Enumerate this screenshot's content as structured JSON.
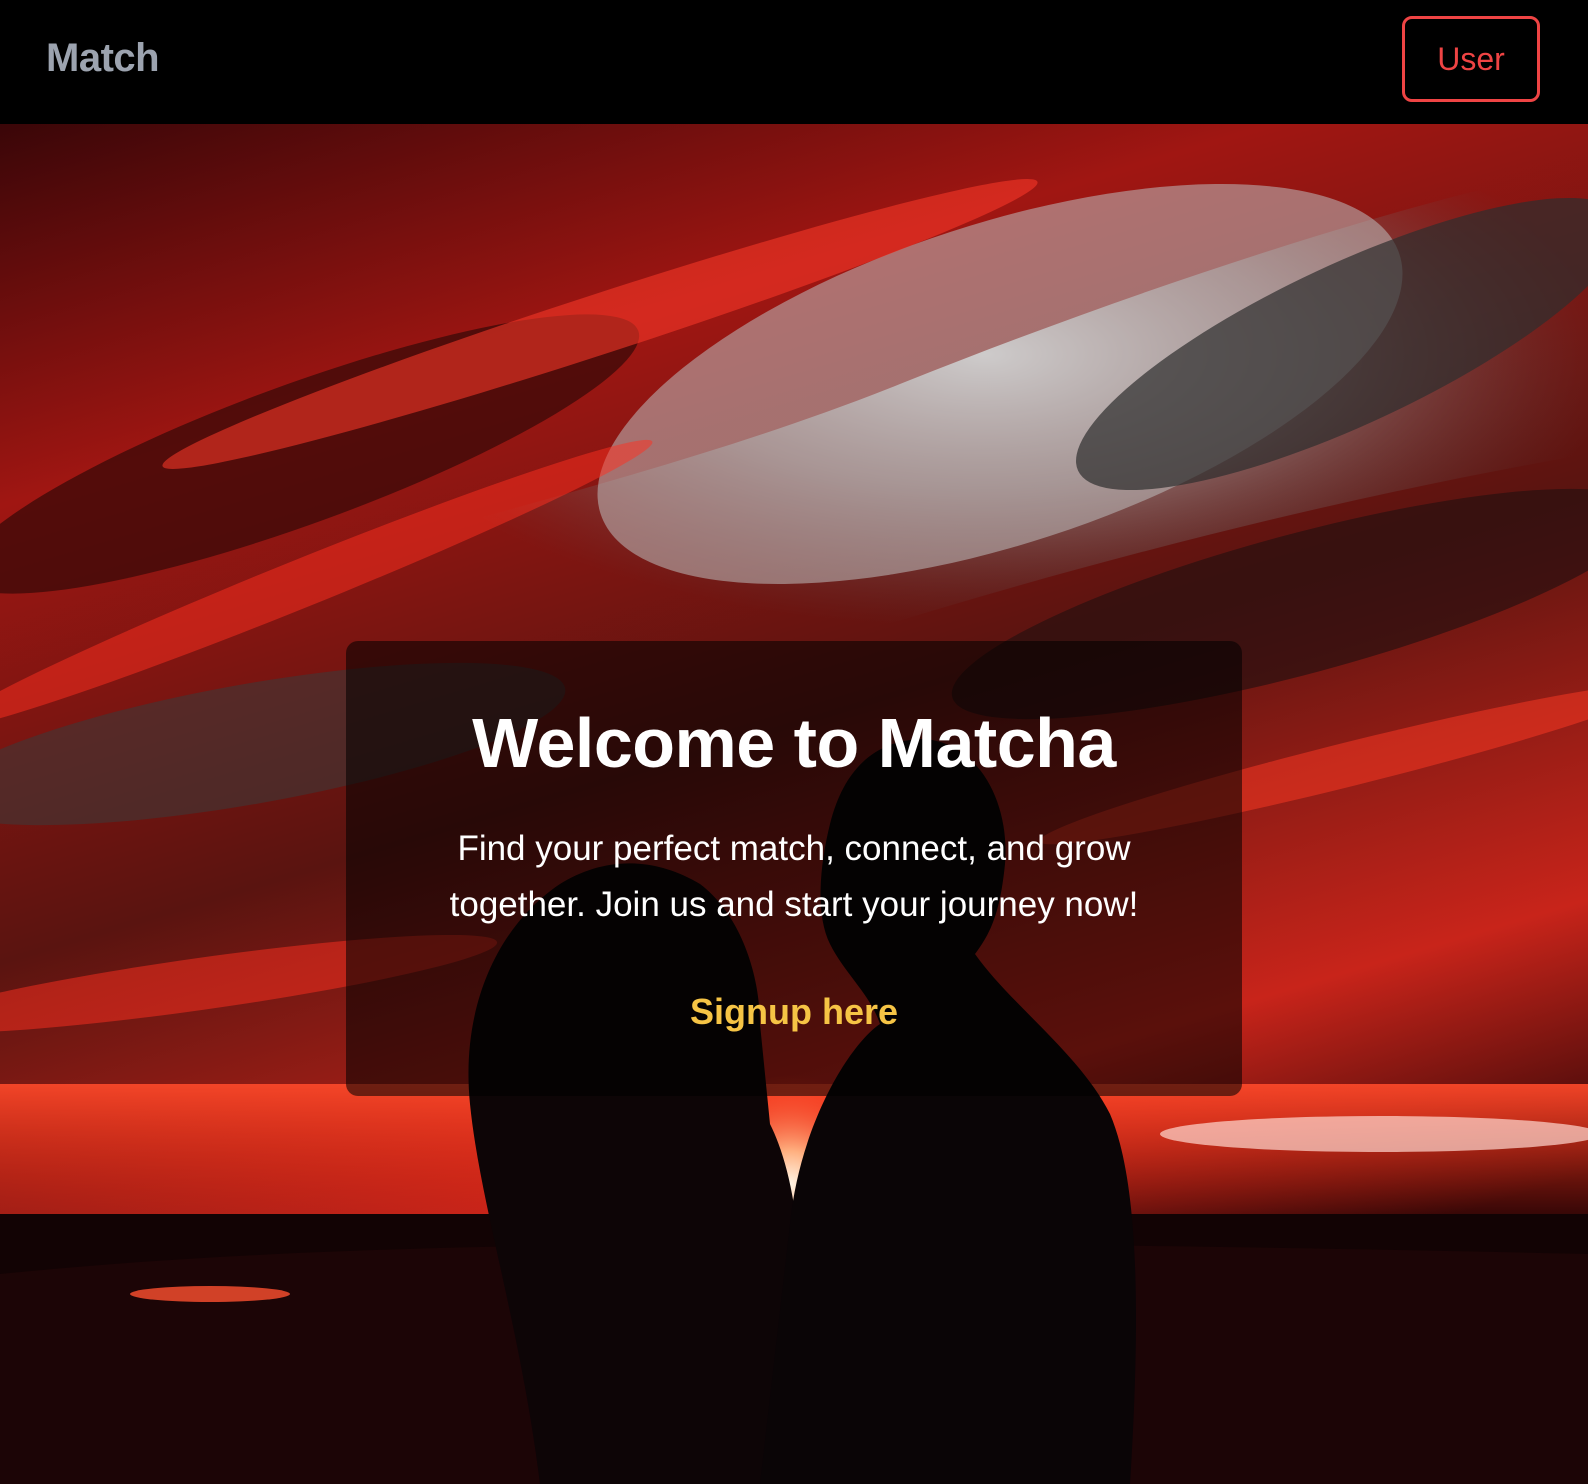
{
  "navbar": {
    "brand": "Match",
    "user_button": "User"
  },
  "hero": {
    "background_image": "couple-silhouette-red-sunset",
    "title": "Welcome to Matcha",
    "description": "Find your perfect match, connect, and grow together. Join us and start your journey now!",
    "signup_link": "Signup here"
  },
  "colors": {
    "navbar_bg": "#000000",
    "brand": "#9ca3af",
    "user_button": "#ef4444",
    "signup_link": "#f6c445",
    "card_bg": "rgba(0,0,0,0.55)"
  }
}
